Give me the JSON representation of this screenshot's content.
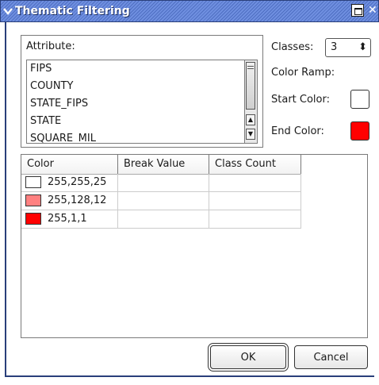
{
  "window": {
    "title": "Thematic Filtering",
    "menu_icon": "chevron-down-icon",
    "shade_icon": "window-shade-icon",
    "close_icon": "close-icon",
    "close_glyph": "✕"
  },
  "attribute": {
    "label": "Attribute:",
    "items": [
      "FIPS",
      "COUNTY",
      "STATE_FIPS",
      "STATE",
      "SQUARE_MIL"
    ]
  },
  "classes": {
    "label": "Classes:",
    "value": "3",
    "arrows": "⬍"
  },
  "color_ramp": {
    "label": "Color Ramp:",
    "start_label": "Start Color:",
    "start_color": "#ffffff",
    "end_label": "End Color:",
    "end_color": "#ff0000"
  },
  "table": {
    "headers": [
      "Color",
      "Break Value",
      "Class Count"
    ],
    "rows": [
      {
        "swatch": "#ffffff",
        "color": "255,255,25",
        "break_value": "",
        "class_count": ""
      },
      {
        "swatch": "#ff8080",
        "color": "255,128,12",
        "break_value": "",
        "class_count": ""
      },
      {
        "swatch": "#ff0101",
        "color": "255,1,1",
        "break_value": "",
        "class_count": ""
      }
    ]
  },
  "buttons": {
    "ok": "OK",
    "cancel": "Cancel"
  },
  "colors": {
    "titlebar": "#5a7bd0",
    "frame": "#2a3f7a"
  }
}
